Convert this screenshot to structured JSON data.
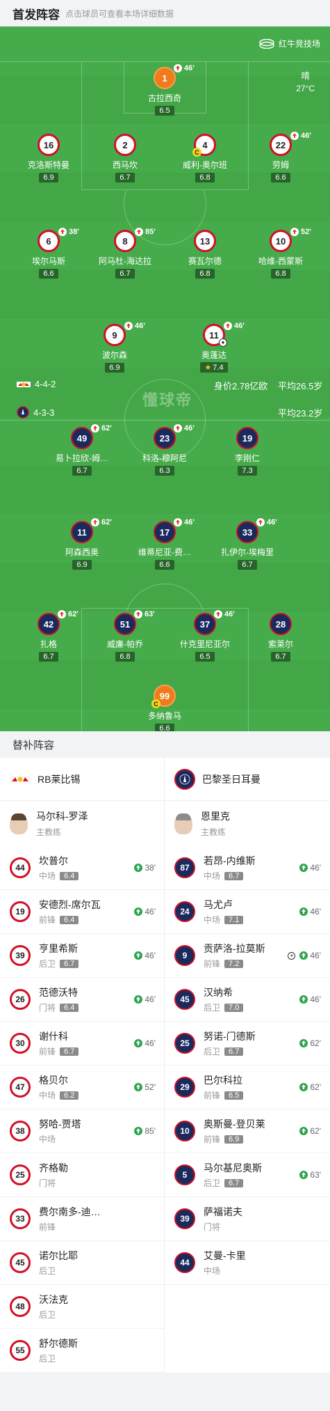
{
  "header": {
    "title": "首发阵容",
    "subtitle": "点击球员可查看本场详细数据"
  },
  "pitch": {
    "venue": "红牛竞技场",
    "weather": "晴",
    "temperature": "27°C",
    "watermark": "懂球帝",
    "home": {
      "formation": "4-4-2",
      "value": "身价2.78亿欧",
      "avg_age": "平均26.5岁"
    },
    "away": {
      "formation": "4-3-3",
      "avg_age": "平均23.2岁"
    },
    "players": [
      {
        "num": "1",
        "name": "古拉西奇",
        "rating": "6.5",
        "sub": "46'",
        "team": "gk"
      },
      {
        "num": "16",
        "name": "克洛斯特曼",
        "rating": "6.9",
        "sub": "",
        "team": "rb"
      },
      {
        "num": "2",
        "name": "西马坎",
        "rating": "6.7",
        "sub": "",
        "team": "rb"
      },
      {
        "num": "4",
        "name": "威利-奥尔班",
        "rating": "6.8",
        "sub": "",
        "team": "rb",
        "captain": "C"
      },
      {
        "num": "22",
        "name": "劳姆",
        "rating": "6.6",
        "sub": "46'",
        "team": "rb"
      },
      {
        "num": "6",
        "name": "埃尔马斯",
        "rating": "6.6",
        "sub": "38'",
        "team": "rb"
      },
      {
        "num": "8",
        "name": "阿马杜-海达拉",
        "rating": "6.7",
        "sub": "85'",
        "team": "rb"
      },
      {
        "num": "13",
        "name": "赛瓦尔德",
        "rating": "6.8",
        "sub": "",
        "team": "rb"
      },
      {
        "num": "10",
        "name": "哈维-西蒙斯",
        "rating": "6.8",
        "sub": "52'",
        "team": "rb"
      },
      {
        "num": "9",
        "name": "波尔森",
        "rating": "6.9",
        "sub": "46'",
        "team": "rb"
      },
      {
        "num": "11",
        "name": "奥蓬达",
        "rating": "7.4",
        "sub": "46'",
        "team": "rb",
        "goal": true,
        "star": "★"
      },
      {
        "num": "49",
        "name": "易卜拉欣-姆…",
        "rating": "6.7",
        "sub": "62'",
        "team": "psg"
      },
      {
        "num": "23",
        "name": "科洛-穆阿尼",
        "rating": "6.3",
        "sub": "46'",
        "team": "psg"
      },
      {
        "num": "19",
        "name": "李刚仁",
        "rating": "7.3",
        "sub": "",
        "team": "psg"
      },
      {
        "num": "11",
        "name": "阿森西奥",
        "rating": "6.9",
        "sub": "62'",
        "team": "psg"
      },
      {
        "num": "17",
        "name": "维蒂尼亚-费…",
        "rating": "6.6",
        "sub": "46'",
        "team": "psg"
      },
      {
        "num": "33",
        "name": "扎伊尔-埃梅里",
        "rating": "6.7",
        "sub": "46'",
        "team": "psg"
      },
      {
        "num": "42",
        "name": "扎格",
        "rating": "6.7",
        "sub": "62'",
        "team": "psg"
      },
      {
        "num": "51",
        "name": "威廉-帕乔",
        "rating": "6.8",
        "sub": "63'",
        "team": "psg"
      },
      {
        "num": "37",
        "name": "什克里尼亚尔",
        "rating": "6.5",
        "sub": "46'",
        "team": "psg"
      },
      {
        "num": "28",
        "name": "索莱尔",
        "rating": "6.7",
        "sub": "",
        "team": "psg"
      },
      {
        "num": "99",
        "name": "多纳鲁马",
        "rating": "6.6",
        "sub": "",
        "team": "gk",
        "captain": "C"
      }
    ]
  },
  "bench": {
    "title": "替补阵容",
    "home": {
      "team": "RB莱比锡",
      "coach": {
        "name": "马尔科-罗泽",
        "role": "主教练"
      },
      "players": [
        {
          "num": "44",
          "name": "坎普尔",
          "pos": "中场",
          "rating": "6.4",
          "in": "38'"
        },
        {
          "num": "19",
          "name": "安德烈-席尔瓦",
          "pos": "前锋",
          "rating": "6.4",
          "in": "46'"
        },
        {
          "num": "39",
          "name": "亨里希斯",
          "pos": "后卫",
          "rating": "6.7",
          "in": "46'"
        },
        {
          "num": "26",
          "name": "范德沃特",
          "pos": "门将",
          "rating": "6.4",
          "in": "46'"
        },
        {
          "num": "30",
          "name": "谢什科",
          "pos": "前锋",
          "rating": "6.7",
          "in": "46'"
        },
        {
          "num": "47",
          "name": "格贝尔",
          "pos": "中场",
          "rating": "6.2",
          "in": "52'"
        },
        {
          "num": "38",
          "name": "努哈-贾塔",
          "pos": "中场",
          "rating": "",
          "in": "85'"
        },
        {
          "num": "25",
          "name": "齐格勒",
          "pos": "门将",
          "rating": "",
          "in": ""
        },
        {
          "num": "33",
          "name": "费尔南多-迪…",
          "pos": "前锋",
          "rating": "",
          "in": ""
        },
        {
          "num": "45",
          "name": "诺尔比耶",
          "pos": "后卫",
          "rating": "",
          "in": ""
        },
        {
          "num": "48",
          "name": "沃法克",
          "pos": "后卫",
          "rating": "",
          "in": ""
        },
        {
          "num": "55",
          "name": "舒尔德斯",
          "pos": "后卫",
          "rating": "",
          "in": ""
        }
      ]
    },
    "away": {
      "team": "巴黎圣日耳曼",
      "coach": {
        "name": "恩里克",
        "role": "主教练"
      },
      "players": [
        {
          "num": "87",
          "name": "若昂-内维斯",
          "pos": "中场",
          "rating": "6.7",
          "in": "46'"
        },
        {
          "num": "24",
          "name": "马尤卢",
          "pos": "中场",
          "rating": "7.1",
          "in": "46'"
        },
        {
          "num": "9",
          "name": "贡萨洛-拉莫斯",
          "pos": "前锋",
          "rating": "7.2",
          "in": "46'",
          "goal": true
        },
        {
          "num": "45",
          "name": "汉纳希",
          "pos": "后卫",
          "rating": "7.0",
          "in": "46'"
        },
        {
          "num": "25",
          "name": "努诺-门德斯",
          "pos": "后卫",
          "rating": "6.7",
          "in": "62'"
        },
        {
          "num": "29",
          "name": "巴尔科拉",
          "pos": "前锋",
          "rating": "6.5",
          "in": "62'"
        },
        {
          "num": "10",
          "name": "奥斯曼-登贝莱",
          "pos": "前锋",
          "rating": "6.9",
          "in": "62'"
        },
        {
          "num": "5",
          "name": "马尔基尼奥斯",
          "pos": "后卫",
          "rating": "6.7",
          "in": "63'"
        },
        {
          "num": "39",
          "name": "萨福诺夫",
          "pos": "门将",
          "rating": "",
          "in": ""
        },
        {
          "num": "44",
          "name": "艾曼-卡里",
          "pos": "中场",
          "rating": "",
          "in": ""
        }
      ]
    }
  }
}
